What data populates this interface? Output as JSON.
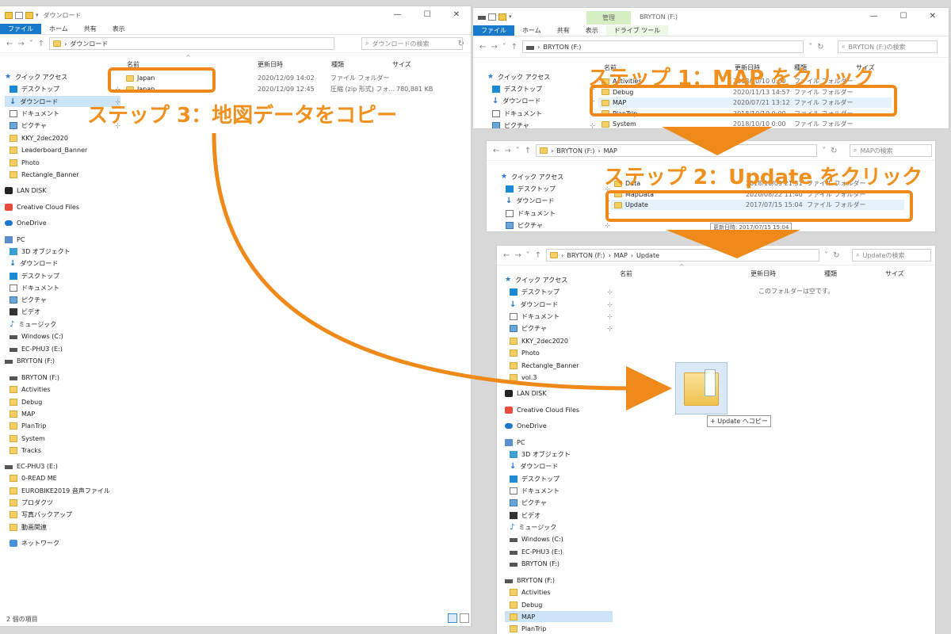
{
  "left_window": {
    "title": "ダウンロード",
    "ribbon": [
      "ファイル",
      "ホーム",
      "共有",
      "表示"
    ],
    "path": "ダウンロード",
    "search_placeholder": "ダウンロードの検索",
    "columns": [
      "名前",
      "更新日時",
      "種類",
      "サイズ"
    ],
    "files": [
      {
        "name": "Japan",
        "date": "2020/12/09 14:02",
        "type": "ファイル フォルダー",
        "size": ""
      },
      {
        "name": "Japan",
        "date": "2020/12/09 12:45",
        "type": "圧縮 (zip 形式) フォ...",
        "size": "780,881 KB"
      }
    ],
    "nav": [
      {
        "label": "クイック アクセス",
        "icon": "star-icon"
      },
      {
        "label": "デスクトップ",
        "icon": "desktop-icon",
        "pinned": true
      },
      {
        "label": "ダウンロード",
        "icon": "download-icon",
        "pinned": true
      },
      {
        "label": "ドキュメント",
        "icon": "document-icon",
        "pinned": true
      },
      {
        "label": "ピクチャ",
        "icon": "picture-icon",
        "pinned": true
      },
      {
        "label": "KKY_2dec2020",
        "icon": "folder-icon"
      },
      {
        "label": "Leaderboard_Banner",
        "icon": "folder-icon"
      },
      {
        "label": "Photo",
        "icon": "folder-icon"
      },
      {
        "label": "Rectangle_Banner",
        "icon": "folder-icon"
      },
      {
        "label": "LAN DISK",
        "icon": "lan-disk-icon"
      },
      {
        "label": "Creative Cloud Files",
        "icon": "creative-cloud-icon"
      },
      {
        "label": "OneDrive",
        "icon": "onedrive-icon"
      },
      {
        "label": "PC",
        "icon": "pc-icon"
      },
      {
        "label": "3D オブジェクト",
        "icon": "3d-objects-icon"
      },
      {
        "label": "ダウンロード",
        "icon": "download-icon"
      },
      {
        "label": "デスクトップ",
        "icon": "desktop-icon"
      },
      {
        "label": "ドキュメント",
        "icon": "document-icon"
      },
      {
        "label": "ピクチャ",
        "icon": "picture-icon"
      },
      {
        "label": "ビデオ",
        "icon": "video-icon"
      },
      {
        "label": "ミュージック",
        "icon": "music-icon"
      },
      {
        "label": "Windows (C:)",
        "icon": "drive-icon"
      },
      {
        "label": "EC-PHU3 (E:)",
        "icon": "drive-icon"
      },
      {
        "label": "BRYTON (F:)",
        "icon": "drive-icon"
      },
      {
        "label": "BRYTON (F:)",
        "icon": "drive-icon"
      },
      {
        "label": "Activities",
        "icon": "folder-icon"
      },
      {
        "label": "Debug",
        "icon": "folder-icon"
      },
      {
        "label": "MAP",
        "icon": "folder-icon"
      },
      {
        "label": "PlanTrip",
        "icon": "folder-icon"
      },
      {
        "label": "System",
        "icon": "folder-icon"
      },
      {
        "label": "Tracks",
        "icon": "folder-icon"
      },
      {
        "label": "EC-PHU3 (E:)",
        "icon": "drive-icon"
      },
      {
        "label": "0-READ ME",
        "icon": "folder-icon"
      },
      {
        "label": "EUROBIKE2019 音声ファイル",
        "icon": "folder-icon"
      },
      {
        "label": "プロダクツ",
        "icon": "folder-icon"
      },
      {
        "label": "写真バックアップ",
        "icon": "folder-icon"
      },
      {
        "label": "動画関連",
        "icon": "folder-icon"
      },
      {
        "label": "ネットワーク",
        "icon": "network-icon"
      }
    ],
    "status": "2 個の項目"
  },
  "right_top": {
    "title": "BRYTON (F:)",
    "manage_tab": "管理",
    "ribbon": [
      "ファイル",
      "ホーム",
      "共有",
      "表示",
      "ドライブ ツール"
    ],
    "path": "BRYTON (F:)",
    "search_placeholder": "BRYTON (F:)の検索",
    "columns": [
      "名前",
      "更新日時",
      "種類",
      "サイズ"
    ],
    "nav": [
      "クイック アクセス",
      "デスクトップ",
      "ダウンロード",
      "ドキュメント",
      "ピクチャ"
    ],
    "files": [
      {
        "name": "Activities",
        "date": "2018/10/10 0:00",
        "type": "ファイル フォルダー"
      },
      {
        "name": "Debug",
        "date": "2020/11/13 14:57",
        "type": "ファイル フォルダー"
      },
      {
        "name": "MAP",
        "date": "2020/07/21 13:12",
        "type": "ファイル フォルダー"
      },
      {
        "name": "PlanTrip",
        "date": "2018/10/10 0:00",
        "type": "ファイル フォルダー"
      },
      {
        "name": "System",
        "date": "2018/10/10 0:00",
        "type": "ファイル フォルダー"
      }
    ]
  },
  "right_mid": {
    "path": [
      "BRYTON (F:)",
      "MAP"
    ],
    "search_placeholder": "MAPの検索",
    "nav": [
      "クイック アクセス",
      "デスクトップ",
      "ダウンロード",
      "ドキュメント",
      "ピクチャ"
    ],
    "files": [
      {
        "name": "Data",
        "date": "2018/10/09 21:51",
        "type": "ファイル フォルダー"
      },
      {
        "name": "MapData",
        "date": "2020/08/22 11:40",
        "type": "ファイル フォルダー"
      },
      {
        "name": "Update",
        "date": "2017/07/15 15:04",
        "type": "ファイル フォルダー"
      }
    ],
    "tooltip": "更新日時: 2017/07/15 15:04"
  },
  "right_bottom": {
    "path": [
      "BRYTON (F:)",
      "MAP",
      "Update"
    ],
    "search_placeholder": "Updateの検索",
    "columns": [
      "名前",
      "更新日時",
      "種類",
      "サイズ"
    ],
    "empty_text": "このフォルダーは空です。",
    "drag_tip": "+ Update へコピー",
    "nav": [
      {
        "label": "クイック アクセス",
        "icon": "star-icon"
      },
      {
        "label": "デスクトップ",
        "icon": "desktop-icon",
        "pinned": true
      },
      {
        "label": "ダウンロード",
        "icon": "download-icon",
        "pinned": true
      },
      {
        "label": "ドキュメント",
        "icon": "document-icon",
        "pinned": true
      },
      {
        "label": "ピクチャ",
        "icon": "picture-icon",
        "pinned": true
      },
      {
        "label": "KKY_2dec2020",
        "icon": "folder-icon"
      },
      {
        "label": "Photo",
        "icon": "folder-icon"
      },
      {
        "label": "Rectangle_Banner",
        "icon": "folder-icon"
      },
      {
        "label": "vol.3",
        "icon": "folder-icon"
      },
      {
        "label": "LAN DISK",
        "icon": "lan-disk-icon"
      },
      {
        "label": "Creative Cloud Files",
        "icon": "creative-cloud-icon"
      },
      {
        "label": "OneDrive",
        "icon": "onedrive-icon"
      },
      {
        "label": "PC",
        "icon": "pc-icon"
      },
      {
        "label": "3D オブジェクト",
        "icon": "3d-objects-icon"
      },
      {
        "label": "ダウンロード",
        "icon": "download-icon"
      },
      {
        "label": "デスクトップ",
        "icon": "desktop-icon"
      },
      {
        "label": "ドキュメント",
        "icon": "document-icon"
      },
      {
        "label": "ピクチャ",
        "icon": "picture-icon"
      },
      {
        "label": "ビデオ",
        "icon": "video-icon"
      },
      {
        "label": "ミュージック",
        "icon": "music-icon"
      },
      {
        "label": "Windows (C:)",
        "icon": "drive-icon"
      },
      {
        "label": "EC-PHU3 (E:)",
        "icon": "drive-icon"
      },
      {
        "label": "BRYTON (F:)",
        "icon": "drive-icon"
      },
      {
        "label": "BRYTON (F:)",
        "icon": "drive-icon"
      },
      {
        "label": "Activities",
        "icon": "folder-icon"
      },
      {
        "label": "Debug",
        "icon": "folder-icon"
      },
      {
        "label": "MAP",
        "icon": "folder-icon"
      },
      {
        "label": "PlanTrip",
        "icon": "folder-icon"
      }
    ]
  },
  "callouts": {
    "step1": "ステップ 1：MAP をクリック",
    "step2": "ステップ 2：Update をクリック",
    "step3": "ステップ 3：地図データをコピー"
  },
  "accent_color": "#ef8a1a"
}
